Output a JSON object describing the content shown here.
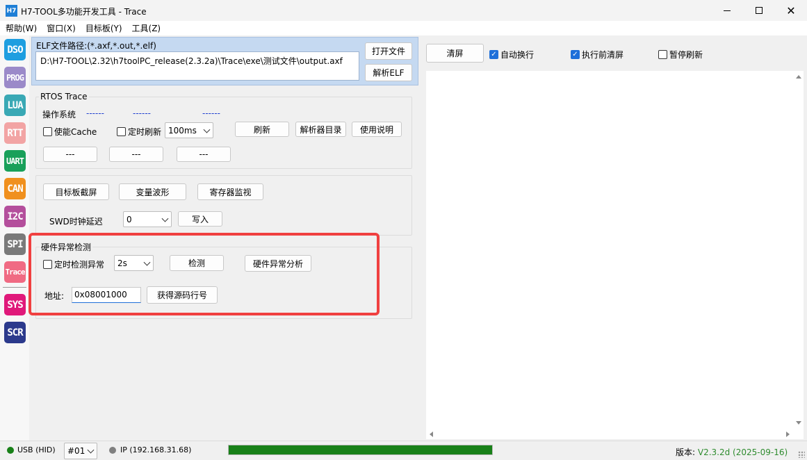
{
  "window": {
    "icon_text": "H7",
    "title": "H7-TOOL多功能开发工具 - Trace"
  },
  "menu": [
    "帮助(W)",
    "窗口(X)",
    "目标板(Y)",
    "工具(Z)"
  ],
  "sidebar": [
    {
      "label": "DSO",
      "color": "#1e9ee0"
    },
    {
      "label": "PROG",
      "color": "#9b8ac9"
    },
    {
      "label": "LUA",
      "color": "#3aa9b5"
    },
    {
      "label": "RTT",
      "color": "#f2a4a4"
    },
    {
      "label": "UART",
      "color": "#19a05a"
    },
    {
      "label": "CAN",
      "color": "#f0901e"
    },
    {
      "label": "I2C",
      "color": "#b44f9c"
    },
    {
      "label": "SPI",
      "color": "#7a7a7a"
    },
    {
      "label": "Trace",
      "color": "#f06a83"
    },
    {
      "label": "SYS",
      "color": "#e0197a"
    },
    {
      "label": "SCR",
      "color": "#2c3a8c"
    }
  ],
  "elf": {
    "label": "ELF文件路径:(*.axf,*.out,*.elf)",
    "path": "D:\\H7-TOOL\\2.32\\h7toolPC_release(2.3.2a)\\Trace\\exe\\测试文件\\output.axf",
    "open_button": "打开文件",
    "parse_button": "解析ELF"
  },
  "rtos": {
    "title": "RTOS Trace",
    "os_label": "操作系统",
    "dash1": "------",
    "dash2": "------",
    "dash3": "------",
    "cache_label": "使能Cache",
    "timer_label": "定时刷新",
    "interval": "100ms",
    "refresh_button": "刷新",
    "parser_dir_button": "解析器目录",
    "help_button": "使用说明",
    "slot1": "---",
    "slot2": "---",
    "slot3": "---"
  },
  "tools": {
    "screenshot_button": "目标板截屏",
    "wave_button": "变量波形",
    "register_button": "寄存器监视",
    "swd_label": "SWD时钟延迟",
    "swd_value": "0",
    "write_button": "写入"
  },
  "hardfault": {
    "title": "硬件异常检测",
    "timer_check_label": "定时检测异常",
    "interval": "2s",
    "check_button": "检测",
    "analyze_button": "硬件异常分析",
    "addr_label": "地址:",
    "addr_value": "0x08001000",
    "source_button": "获得源码行号"
  },
  "right": {
    "clear_button": "清屏",
    "auto_wrap_label": "自动换行",
    "auto_wrap_checked": true,
    "clear_before_label": "执行前清屏",
    "clear_before_checked": true,
    "pause_label": "暂停刷新",
    "pause_checked": false
  },
  "status": {
    "usb": "USB (HID)",
    "device": "#01",
    "ip": "IP (192.168.31.68)",
    "progress": 1.0,
    "version_label": "版本:",
    "version_value": "V2.3.2d (2025-09-16)"
  },
  "colors": {
    "accent": "#1e6fd9",
    "highlight": "#f04040",
    "progress": "#188018",
    "version": "#2e8b2e"
  }
}
